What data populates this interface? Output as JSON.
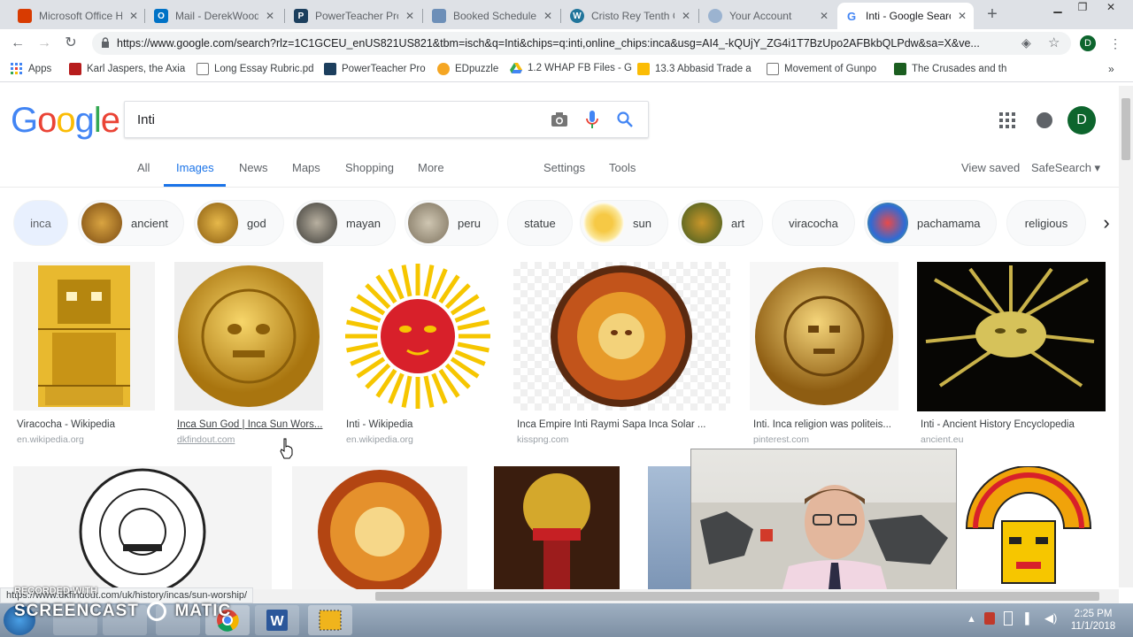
{
  "browser": {
    "tabs": [
      {
        "title": "Microsoft Office Ho",
        "color": "#d83b01",
        "icon": "office-icon"
      },
      {
        "title": "Mail - DerekWood",
        "color": "#0072c6",
        "icon": "outlook-icon"
      },
      {
        "title": "PowerTeacher Pro",
        "color": "#1c3f5e",
        "icon": "powerteacher-icon"
      },
      {
        "title": "Booked Scheduler",
        "color": "#6d8fb8",
        "icon": "booked-icon"
      },
      {
        "title": "Cristo Rey Tenth G",
        "color": "#21759b",
        "icon": "wordpress-icon"
      },
      {
        "title": "Your Account",
        "color": "#9bb3d0",
        "icon": "account-icon"
      },
      {
        "title": "Inti - Google Searc",
        "color": "#4285f4",
        "icon": "google-icon"
      }
    ],
    "url": "https://www.google.com/search?rlz=1C1GCEU_enUS821US821&tbm=isch&q=Inti&chips=q:inti,online_chips:inca&usg=AI4_-kQUjY_ZG4i1T7BzUpo2AFBkbQLPdw&sa=X&ve...",
    "profile_initial": "D",
    "bookmarks": [
      {
        "label": "Apps",
        "color": "#4285f4"
      },
      {
        "label": "Karl Jaspers, the Axia",
        "color": "#b71c1c"
      },
      {
        "label": "Long Essay Rubric.pd",
        "color": "#ffffff"
      },
      {
        "label": "PowerTeacher Pro",
        "color": "#1c3f5e"
      },
      {
        "label": "EDpuzzle",
        "color": "#f5a623"
      },
      {
        "label": "1.2 WHAP FB Files - G",
        "color": "#34a853"
      },
      {
        "label": "13.3 Abbasid Trade a",
        "color": "#fbbc05"
      },
      {
        "label": "Movement of Gunpo",
        "color": "#ffffff"
      },
      {
        "label": "The Crusades and th",
        "color": "#1b5e20"
      }
    ]
  },
  "search": {
    "logo": [
      "G",
      "o",
      "o",
      "g",
      "l",
      "e"
    ],
    "query": "Inti",
    "nav": {
      "all": "All",
      "images": "Images",
      "news": "News",
      "maps": "Maps",
      "shopping": "Shopping",
      "more": "More",
      "settings": "Settings",
      "tools": "Tools",
      "view_saved": "View saved",
      "safesearch": "SafeSearch ▾"
    },
    "chips": [
      "inca",
      "ancient",
      "god",
      "mayan",
      "peru",
      "statue",
      "sun",
      "art",
      "viracocha",
      "pachamama",
      "religious"
    ]
  },
  "results": [
    {
      "title": "Viracocha - Wikipedia",
      "domain": "en.wikipedia.org"
    },
    {
      "title": "Inca Sun God | Inca Sun Wors...",
      "domain": "dkfindout.com"
    },
    {
      "title": "Inti - Wikipedia",
      "domain": "en.wikipedia.org"
    },
    {
      "title": "Inca Empire Inti Raymi Sapa Inca Solar ...",
      "domain": "kisspng.com"
    },
    {
      "title": "Inti. Inca religion was politeis...",
      "domain": "pinterest.com"
    },
    {
      "title": "Inti - Ancient History Encyclopedia",
      "domain": "ancient.eu"
    }
  ],
  "status_url": "https://www.dkfindout.com/uk/history/incas/sun-worship/",
  "overlay": {
    "recorded_with": "RECORDED WITH",
    "screencast": "SCREENCAST",
    "matic": "MATIC"
  },
  "taskbar": {
    "time": "2:25 PM",
    "date": "11/1/2018"
  },
  "colors": {
    "accent": "#1a73e8",
    "google_blue": "#4285f4",
    "google_red": "#ea4335",
    "google_yellow": "#fbbc05",
    "google_green": "#34a853"
  }
}
